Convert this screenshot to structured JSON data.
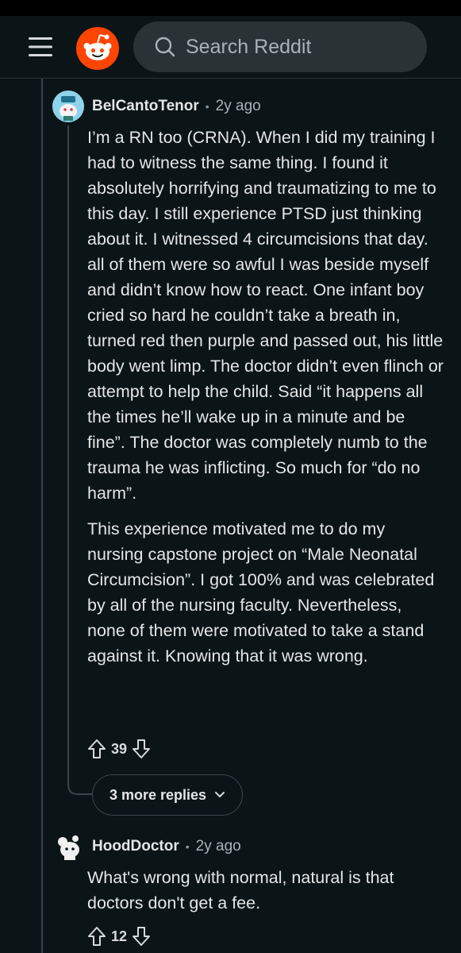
{
  "search": {
    "placeholder": "Search Reddit"
  },
  "comments": [
    {
      "username": "BelCantoTenor",
      "age": "2y ago",
      "paragraphs": [
        "I’m a RN too (CRNA). When I did my training I had to witness the same thing. I found it absolutely horrifying and traumatizing to me to this day. I still experience PTSD just thinking about it. I witnessed 4 circumcisions that day. all of them were so awful I was beside myself and didn’t know how to react. One infant boy cried so hard he couldn’t take a breath in, turned red then purple and passed out, his little body went limp. The doctor didn’t even flinch or attempt to help the child. Said “it happens all the times he’ll wake up in a minute and be fine”. The doctor was completely numb to the trauma he was inflicting. So much for “do no harm”.",
        "This experience motivated me to do my nursing capstone project on “Male Neonatal Circumcision”. I got 100% and was celebrated by all of the nursing faculty. Nevertheless, none of them were motivated to take a stand against it. Knowing that it was wrong."
      ],
      "votes": "39",
      "more_replies": "3 more replies"
    },
    {
      "username": "HoodDoctor",
      "age": "2y ago",
      "paragraphs": [
        "What's wrong with normal, natural is that doctors don't get a fee."
      ],
      "votes": "12"
    }
  ],
  "separator": "•",
  "icons": {
    "menu": "hamburger-menu-icon",
    "logo": "reddit-logo",
    "search": "search-icon",
    "upvote": "upvote-arrow-icon",
    "downvote": "downvote-arrow-icon",
    "expand": "chevron-down-icon"
  },
  "colors": {
    "background": "#0b1416",
    "search_bg": "#2a3236",
    "brand": "#ff4500",
    "text": "#e4e6e7",
    "muted": "#a8b3b7"
  }
}
